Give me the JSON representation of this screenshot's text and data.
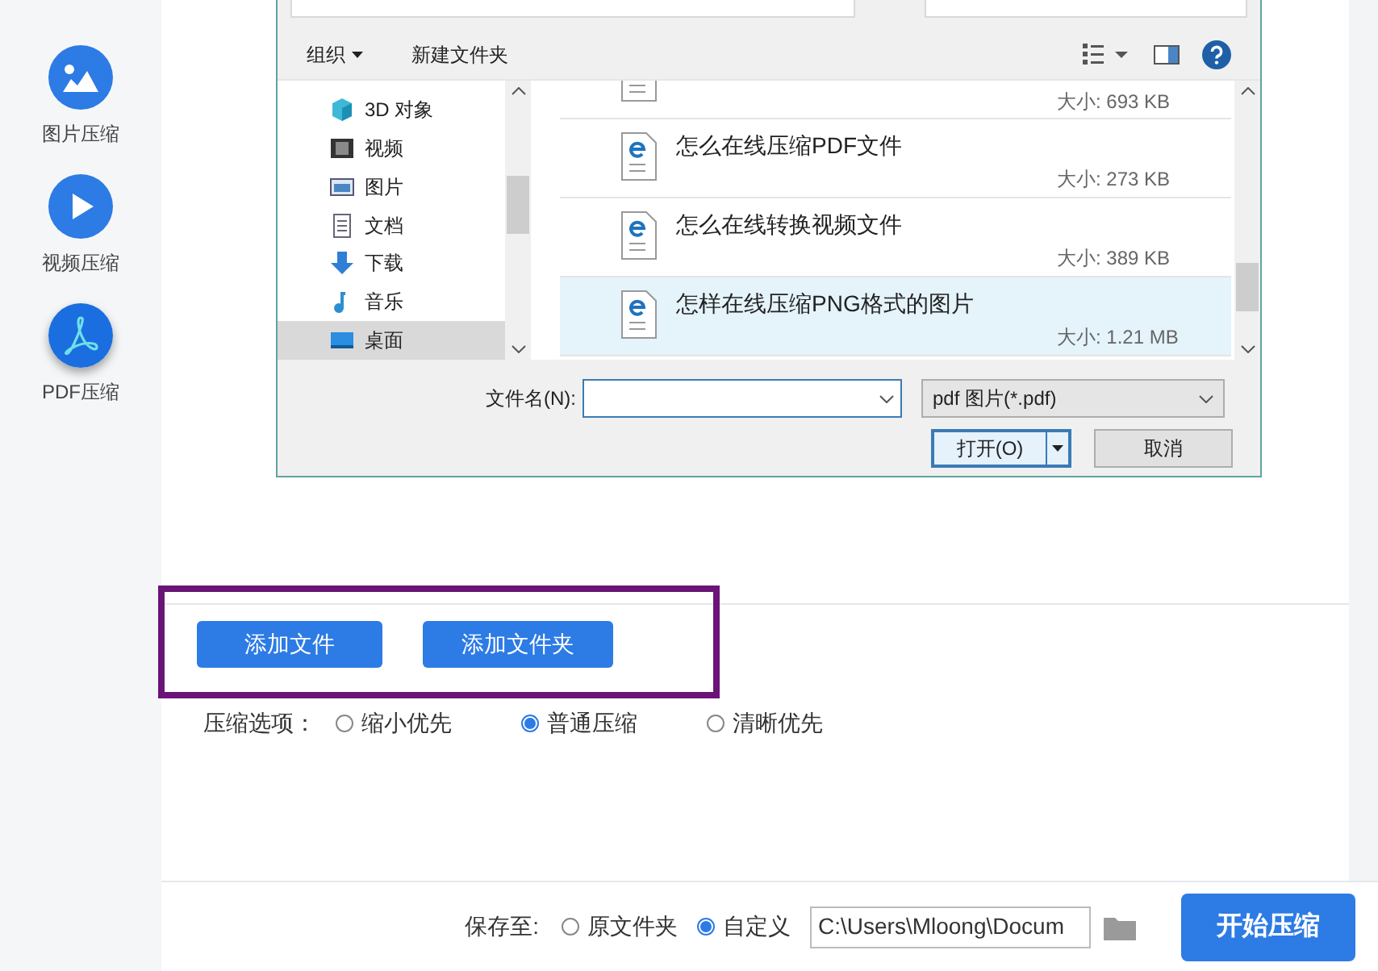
{
  "sidebar": {
    "items": [
      {
        "label": "图片压缩",
        "selected": false
      },
      {
        "label": "视频压缩",
        "selected": false
      },
      {
        "label": "PDF压缩",
        "selected": true
      }
    ]
  },
  "dialog": {
    "toolbar": {
      "organize": "组织",
      "new_folder": "新建文件夹"
    },
    "nav_items": [
      {
        "label": "3D 对象",
        "selected": false
      },
      {
        "label": "视频",
        "selected": false
      },
      {
        "label": "图片",
        "selected": false
      },
      {
        "label": "文档",
        "selected": false
      },
      {
        "label": "下载",
        "selected": false
      },
      {
        "label": "音乐",
        "selected": false
      },
      {
        "label": "桌面",
        "selected": true
      }
    ],
    "files": [
      {
        "size": "大小: 693 KB",
        "selected": false
      },
      {
        "name": "怎么在线压缩PDF文件",
        "size": "大小: 273 KB",
        "selected": false
      },
      {
        "name": "怎么在线转换视频文件",
        "size": "大小: 389 KB",
        "selected": false
      },
      {
        "name": "怎样在线压缩PNG格式的图片",
        "size": "大小: 1.21 MB",
        "selected": true
      }
    ],
    "filename_label": "文件名(N):",
    "filter": "pdf 图片(*.pdf)",
    "open_button": "打开(O)",
    "cancel_button": "取消"
  },
  "main": {
    "buttons": [
      "添加文件",
      "添加文件夹"
    ],
    "compression_label": "压缩选项：",
    "compression_options": [
      {
        "label": "缩小优先",
        "selected": false
      },
      {
        "label": "普通压缩",
        "selected": true
      },
      {
        "label": "清晰优先",
        "selected": false
      }
    ]
  },
  "footer": {
    "save_label": "保存至:",
    "save_options": [
      {
        "label": "原文件夹",
        "selected": false
      },
      {
        "label": "自定义",
        "selected": true
      }
    ],
    "path": "C:\\Users\\Mloong\\Docum",
    "start_button": "开始压缩"
  }
}
